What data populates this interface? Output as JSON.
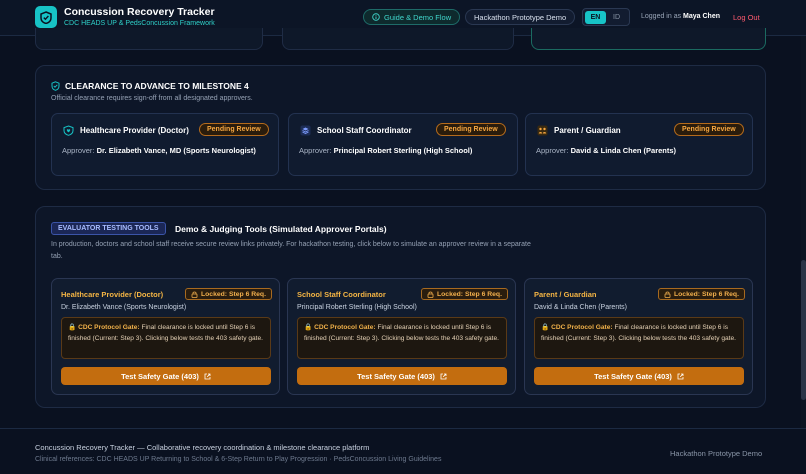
{
  "header": {
    "title": "Concussion Recovery Tracker",
    "subtitle": "CDC HEADS UP & PedsConcussion Framework",
    "guide_label": "Guide & Demo Flow",
    "prototype_label": "Hackathon Prototype Demo",
    "lang_en": "EN",
    "lang_id": "ID",
    "logged_prefix": "Logged in as",
    "user_name": "Maya Chen",
    "logout_label": "Log Out"
  },
  "clearance": {
    "title": "CLEARANCE TO ADVANCE TO MILESTONE 4",
    "description": "Official clearance requires sign-off from all designated approvers.",
    "approvers": [
      {
        "role": "Healthcare Provider (Doctor)",
        "status": "Pending Review",
        "approver_prefix": "Approver:",
        "approver_name": "Dr. Elizabeth Vance, MD (Sports Neurologist)",
        "icon": "heart-shield-icon"
      },
      {
        "role": "School Staff Coordinator",
        "status": "Pending Review",
        "approver_prefix": "Approver:",
        "approver_name": "Principal Robert Sterling (High School)",
        "icon": "layers-icon"
      },
      {
        "role": "Parent / Guardian",
        "status": "Pending Review",
        "approver_prefix": "Approver:",
        "approver_name": "David & Linda Chen (Parents)",
        "icon": "family-icon"
      }
    ]
  },
  "evaluator": {
    "badge": "EVALUATOR TESTING TOOLS",
    "title": "Demo & Judging Tools (Simulated Approver Portals)",
    "description": "In production, doctors and school staff receive secure review links privately. For hackathon testing, click below to simulate an approver review in a separate tab.",
    "portals": [
      {
        "role": "Healthcare Provider (Doctor)",
        "locked": "Locked: Step 6 Req.",
        "name": "Dr. Elizabeth Vance (Sports Neurologist)",
        "gate_label": "CDC Protocol Gate:",
        "gate_text": "Final clearance is locked until Step 6 is finished (Current: Step 3). Clicking below tests the 403 safety gate.",
        "button": "Test Safety Gate (403)"
      },
      {
        "role": "School Staff Coordinator",
        "locked": "Locked: Step 6 Req.",
        "name": "Principal Robert Sterling (High School)",
        "gate_label": "CDC Protocol Gate:",
        "gate_text": "Final clearance is locked until Step 6 is finished (Current: Step 3). Clicking below tests the 403 safety gate.",
        "button": "Test Safety Gate (403)"
      },
      {
        "role": "Parent / Guardian",
        "locked": "Locked: Step 6 Req.",
        "name": "David & Linda Chen (Parents)",
        "gate_label": "CDC Protocol Gate:",
        "gate_text": "Final clearance is locked until Step 6 is finished (Current: Step 3). Clicking below tests the 403 safety gate.",
        "button": "Test Safety Gate (403)"
      }
    ]
  },
  "footer": {
    "line1": "Concussion Recovery Tracker — Collaborative recovery coordination & milestone clearance platform",
    "line2": "Clinical references: CDC HEADS UP Returning to School & 6-Step Return to Play Progression · PedsConcussion Living Guidelines",
    "right": "Hackathon Prototype Demo"
  },
  "colors": {
    "accent": "#17c3c6",
    "warning": "#f5a640",
    "danger": "#ff5a6e",
    "button": "#c36d0f"
  }
}
